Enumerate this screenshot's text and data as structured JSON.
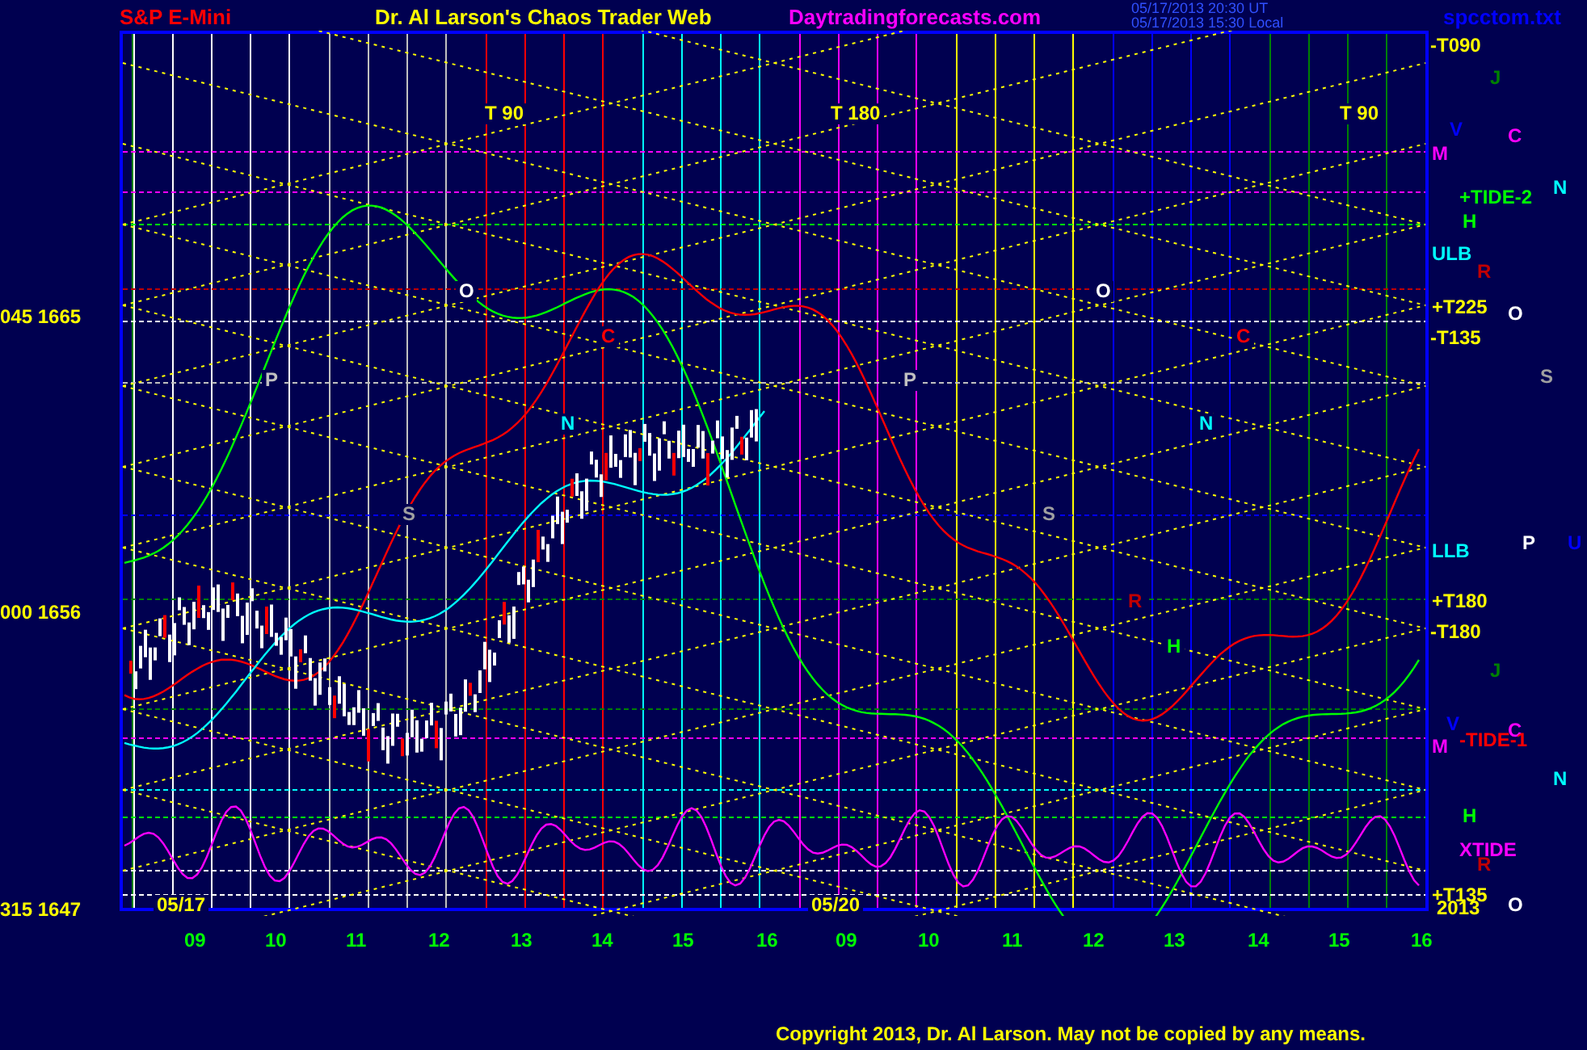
{
  "header": {
    "instrument": "S&P E-Mini",
    "title": "Dr. Al Larson's Chaos Trader Web",
    "site": "Daytradingforecasts.com",
    "times": [
      "05/17/2013 20:30 UT",
      "05/17/2013 15:30 Local"
    ],
    "file": "spcctom.txt"
  },
  "chart": {
    "price_labels": [
      "045  1665",
      "000  1656",
      "315  1647"
    ],
    "markers": [
      {
        "text": "T  90"
      },
      {
        "text": "T  180"
      },
      {
        "text": "T  90"
      }
    ],
    "dates": [
      "05/17",
      "05/20"
    ],
    "letters": [
      {
        "text": "O",
        "color": "#ffffff"
      },
      {
        "text": "C",
        "color": "#ff0000"
      },
      {
        "text": "P",
        "color": "#c0c0c0"
      },
      {
        "text": "N",
        "color": "#00ffff"
      },
      {
        "text": "S",
        "color": "#a0a0a0"
      },
      {
        "text": "O",
        "color": "#ffffff"
      },
      {
        "text": "C",
        "color": "#ff0000"
      },
      {
        "text": "P",
        "color": "#c0c0c0"
      },
      {
        "text": "N",
        "color": "#00ffff"
      },
      {
        "text": "S",
        "color": "#a0a0a0"
      },
      {
        "text": "R",
        "color": "#c00000"
      },
      {
        "text": "H",
        "color": "#00ff00"
      }
    ],
    "right_labels": [
      {
        "text": "-T090",
        "color": "#ffff00"
      },
      {
        "text": "J",
        "color": "#008000"
      },
      {
        "text": "V",
        "color": "#0000ff"
      },
      {
        "text": "C",
        "color": "#ff00ff"
      },
      {
        "text": "M",
        "color": "#ff00ff"
      },
      {
        "text": "+TIDE-2",
        "color": "#00ff00"
      },
      {
        "text": "N",
        "color": "#00ffff"
      },
      {
        "text": "H",
        "color": "#00ff00"
      },
      {
        "text": "ULB",
        "color": "#00ffff"
      },
      {
        "text": "R",
        "color": "#c00000"
      },
      {
        "text": "+T225",
        "color": "#ffff00"
      },
      {
        "text": "O",
        "color": "#ffffff"
      },
      {
        "text": "-T135",
        "color": "#ffff00"
      },
      {
        "text": "S",
        "color": "#a0a0a0"
      },
      {
        "text": "LLB",
        "color": "#00ffff"
      },
      {
        "text": "P",
        "color": "#ffffff"
      },
      {
        "text": "U",
        "color": "#0000ff"
      },
      {
        "text": "+T180",
        "color": "#ffff00"
      },
      {
        "text": "-T180",
        "color": "#ffff00"
      },
      {
        "text": "J",
        "color": "#008000"
      },
      {
        "text": "V",
        "color": "#0000ff"
      },
      {
        "text": "C",
        "color": "#ff00ff"
      },
      {
        "text": "M",
        "color": "#ff00ff"
      },
      {
        "text": "-TIDE-1",
        "color": "#ff0000"
      },
      {
        "text": "N",
        "color": "#00ffff"
      },
      {
        "text": "H",
        "color": "#00ff00"
      },
      {
        "text": "XTIDE",
        "color": "#ff00ff"
      },
      {
        "text": "R",
        "color": "#c00000"
      },
      {
        "text": "+T135",
        "color": "#ffff00"
      },
      {
        "text": "2013",
        "color": "#ffff00"
      },
      {
        "text": "O",
        "color": "#ffffff"
      }
    ],
    "x_labels": [
      "09",
      "10",
      "11",
      "12",
      "13",
      "14",
      "15",
      "16",
      "09",
      "10",
      "11",
      "12",
      "13",
      "14",
      "15",
      "16"
    ]
  },
  "copyright": "Copyright 2013, Dr. Al Larson. May not be copied by any means."
}
